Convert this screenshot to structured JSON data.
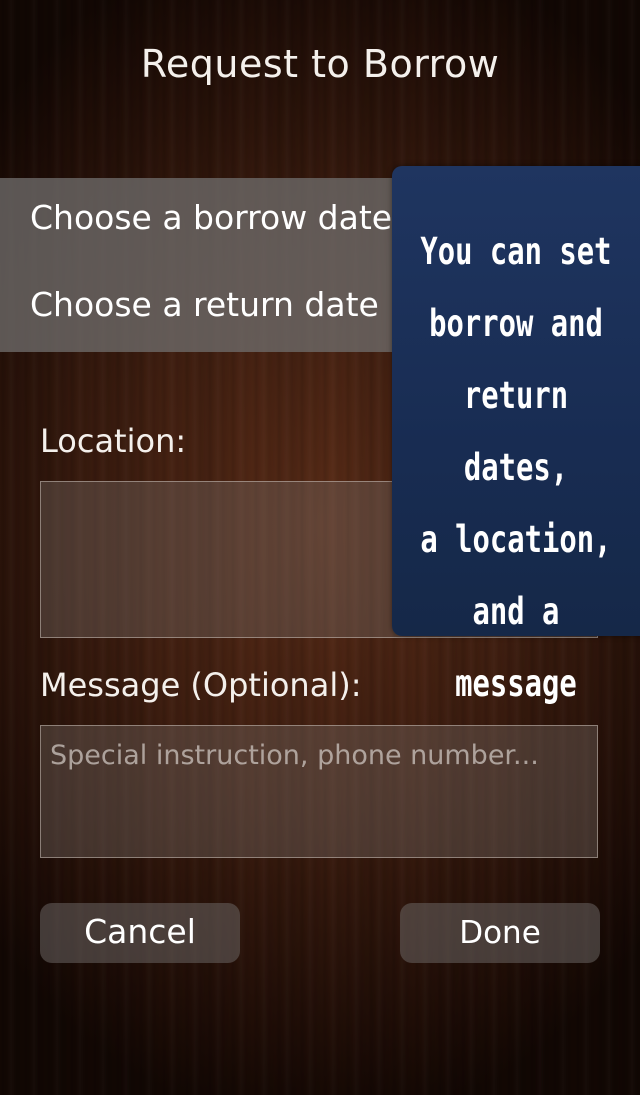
{
  "header": {
    "title": "Request to Borrow"
  },
  "dates": {
    "borrow_label": "Choose a borrow date",
    "return_label": "Choose a return date"
  },
  "location": {
    "label": "Location:",
    "value": ""
  },
  "message": {
    "label": "Message (Optional):",
    "placeholder": "Special instruction, phone number...",
    "value": ""
  },
  "buttons": {
    "cancel_label": "Cancel",
    "done_label": "Done"
  },
  "tooltip": {
    "text": "You can set\nborrow and\nreturn dates,\na location,\nand a message"
  },
  "colors": {
    "tooltip_background": "#1b3058",
    "panel_background": "#6e6c6a",
    "wood_background": "#3f1e10"
  }
}
